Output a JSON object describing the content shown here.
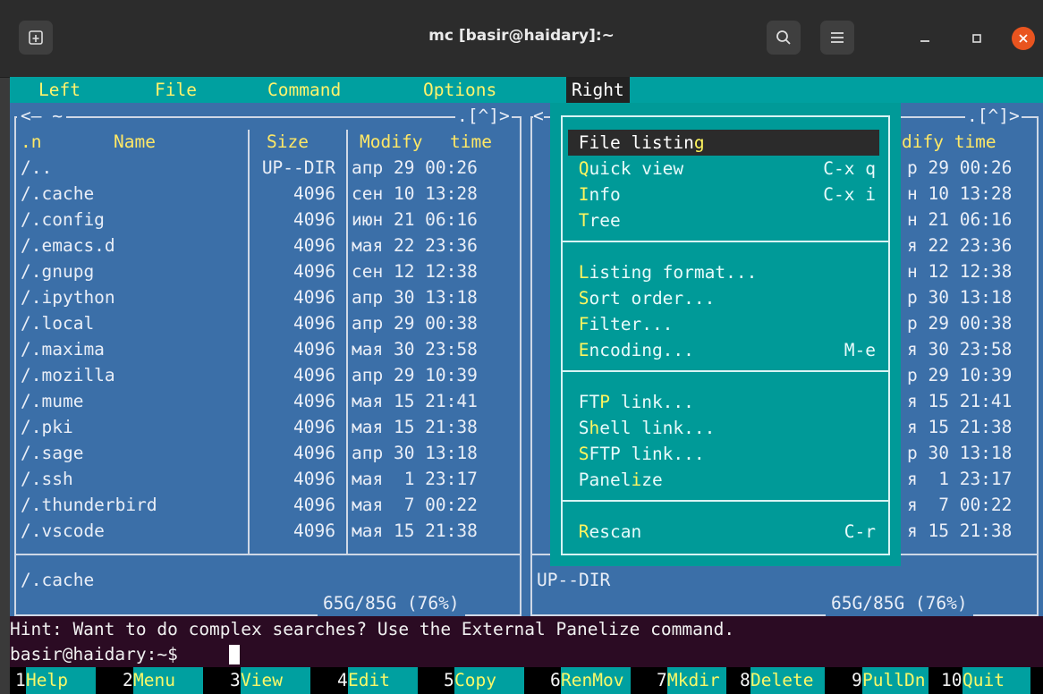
{
  "window": {
    "title": "mc [basir@haidary]:~"
  },
  "menubar": {
    "items": [
      "Left",
      "File",
      "Command",
      "Options",
      "Right"
    ],
    "active": "Right"
  },
  "left_panel": {
    "path_header": "<— ~",
    "history_button": ".[^]>",
    "columns": {
      "name_prefix": ".n",
      "name": "Name",
      "size": "Size",
      "modify": "Modify",
      "time": "time"
    },
    "rows": [
      {
        "name": "/..",
        "size": "UP--DIR",
        "mon": "апр",
        "day": "29",
        "time": "00:26"
      },
      {
        "name": "/.cache",
        "size": "4096",
        "mon": "сен",
        "day": "10",
        "time": "13:28"
      },
      {
        "name": "/.config",
        "size": "4096",
        "mon": "июн",
        "day": "21",
        "time": "06:16"
      },
      {
        "name": "/.emacs.d",
        "size": "4096",
        "mon": "мая",
        "day": "22",
        "time": "23:36"
      },
      {
        "name": "/.gnupg",
        "size": "4096",
        "mon": "сен",
        "day": "12",
        "time": "12:38"
      },
      {
        "name": "/.ipython",
        "size": "4096",
        "mon": "апр",
        "day": "30",
        "time": "13:18"
      },
      {
        "name": "/.local",
        "size": "4096",
        "mon": "апр",
        "day": "29",
        "time": "00:38"
      },
      {
        "name": "/.maxima",
        "size": "4096",
        "mon": "мая",
        "day": "30",
        "time": "23:58"
      },
      {
        "name": "/.mozilla",
        "size": "4096",
        "mon": "апр",
        "day": "29",
        "time": "10:39"
      },
      {
        "name": "/.mume",
        "size": "4096",
        "mon": "мая",
        "day": "15",
        "time": "21:41"
      },
      {
        "name": "/.pki",
        "size": "4096",
        "mon": "мая",
        "day": "15",
        "time": "21:38"
      },
      {
        "name": "/.sage",
        "size": "4096",
        "mon": "апр",
        "day": "30",
        "time": "13:18"
      },
      {
        "name": "/.ssh",
        "size": "4096",
        "mon": "мая",
        "day": " 1",
        "time": "23:17"
      },
      {
        "name": "/.thunderbird",
        "size": "4096",
        "mon": "мая",
        "day": " 7",
        "time": "00:22"
      },
      {
        "name": "/.vscode",
        "size": "4096",
        "mon": "мая",
        "day": "15",
        "time": "21:38"
      }
    ],
    "status": "/.cache",
    "disk": "65G/85G (76%)"
  },
  "right_panel": {
    "path_header": "<",
    "history_button": ".[^]>",
    "header_fragment": "dify time",
    "rows": [
      {
        "mon": "р",
        "day": "29",
        "time": "00:26"
      },
      {
        "mon": "н",
        "day": "10",
        "time": "13:28"
      },
      {
        "mon": "н",
        "day": "21",
        "time": "06:16"
      },
      {
        "mon": "я",
        "day": "22",
        "time": "23:36"
      },
      {
        "mon": "н",
        "day": "12",
        "time": "12:38"
      },
      {
        "mon": "р",
        "day": "30",
        "time": "13:18"
      },
      {
        "mon": "р",
        "day": "29",
        "time": "00:38"
      },
      {
        "mon": "я",
        "day": "30",
        "time": "23:58"
      },
      {
        "mon": "р",
        "day": "29",
        "time": "10:39"
      },
      {
        "mon": "я",
        "day": "15",
        "time": "21:41"
      },
      {
        "mon": "я",
        "day": "15",
        "time": "21:38"
      },
      {
        "mon": "р",
        "day": "30",
        "time": "13:18"
      },
      {
        "mon": "я",
        "day": " 1",
        "time": "23:17"
      },
      {
        "mon": "я",
        "day": " 7",
        "time": "00:22"
      },
      {
        "mon": "я",
        "day": "15",
        "time": "21:38"
      }
    ],
    "status": "UP--DIR",
    "disk": "65G/85G (76%)"
  },
  "right_menu": {
    "groups": [
      [
        {
          "label": "File listing",
          "hotkey_index": 11,
          "shortcut": ""
        },
        {
          "label": "Quick view",
          "hotkey_index": 0,
          "shortcut": "C-x q"
        },
        {
          "label": "Info",
          "hotkey_index": 0,
          "shortcut": "C-x i"
        },
        {
          "label": "Tree",
          "hotkey_index": 0,
          "shortcut": ""
        }
      ],
      [
        {
          "label": "Listing format...",
          "hotkey_index": 0,
          "shortcut": ""
        },
        {
          "label": "Sort order...",
          "hotkey_index": 0,
          "shortcut": ""
        },
        {
          "label": "Filter...",
          "hotkey_index": 0,
          "shortcut": ""
        },
        {
          "label": "Encoding...",
          "hotkey_index": 0,
          "shortcut": "M-e"
        }
      ],
      [
        {
          "label": "FTP link...",
          "hotkey_index": 2,
          "shortcut": ""
        },
        {
          "label": "Shell link...",
          "hotkey_index": 1,
          "shortcut": ""
        },
        {
          "label": "SFTP link...",
          "hotkey_index": 0,
          "shortcut": ""
        },
        {
          "label": "Panelize",
          "hotkey_index": 5,
          "shortcut": ""
        }
      ],
      [
        {
          "label": "Rescan",
          "hotkey_index": 0,
          "shortcut": "C-r"
        }
      ]
    ],
    "selected": "File listing"
  },
  "hint": "Hint: Want to do complex searches? Use the External Panelize command.",
  "prompt": "basir@haidary:~$ ",
  "function_keys": [
    {
      "num": "1",
      "label": "Help"
    },
    {
      "num": "2",
      "label": "Menu"
    },
    {
      "num": "3",
      "label": "View"
    },
    {
      "num": "4",
      "label": "Edit"
    },
    {
      "num": "5",
      "label": "Copy"
    },
    {
      "num": "6",
      "label": "RenMov"
    },
    {
      "num": "7",
      "label": "Mkdir"
    },
    {
      "num": "8",
      "label": "Delete"
    },
    {
      "num": "9",
      "label": "PullDn"
    },
    {
      "num": "10",
      "label": "Quit"
    }
  ],
  "colors": {
    "panel_bg": "#3b6fa8",
    "menu_bg": "#009a98",
    "menubar_bg": "#00a0a0",
    "hint_bg": "#2b0b23",
    "close_button": "#e9541f"
  },
  "icons": [
    "new-tab-icon",
    "search-icon",
    "hamburger-menu-icon",
    "minimize-icon",
    "maximize-icon",
    "close-icon"
  ]
}
